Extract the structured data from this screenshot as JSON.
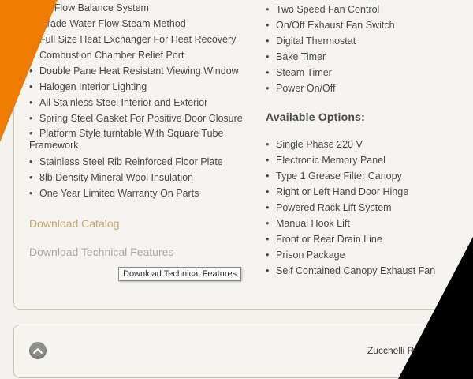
{
  "left_features": [
    "Air Flow Balance System",
    "Grade Water Flow Steam Method",
    "Full Size Heat Exchanger For Heat Recovery",
    "Combustion Chamber Relief Port",
    "Double Pane Heat Resistant Viewing Window",
    "Halogen Interior Lighting",
    "All Stainless Steel Interior and Exterior",
    "Spring Steel Gasket For Positive Door Closure",
    "Platform Style turntable With Square Tube",
    "Framework",
    "Stainless Steel Rib Reinforced Floor Plate",
    "8lb Density Mineral Wool Insulation",
    "One Year Limited Warranty On Parts"
  ],
  "right_features": [
    "Two Speed Fan Control",
    "On/Off Exhaust Fan Switch",
    "Digital Thermostat",
    "Bake Timer",
    "Steam Timer",
    "Power On/Off"
  ],
  "options_title": "Available Options:",
  "options": [
    "Single Phase 220 V",
    "Electronic Memory Panel",
    "Type 1 Grease Filter Canopy",
    "Right or Left Hand Door Hinge",
    "Powered Rack Lift System",
    "Manual Hook Lift",
    "Front or Rear Drain Line",
    "Prison Package",
    "Self Contained Canopy Exhaust Fan"
  ],
  "links": {
    "catalog": "Download Catalog",
    "technical": "Download Technical Features"
  },
  "tooltip": "Download Technical Features",
  "footer": {
    "brand": "Zucchelli R"
  },
  "icons": {
    "scroll_top": "chevron-up-icon"
  },
  "colors": {
    "accent_orange": "#ef7b00",
    "link_gold": "#c8a46a",
    "link_muted": "#a9a9a9",
    "black_deco": "#000000"
  }
}
